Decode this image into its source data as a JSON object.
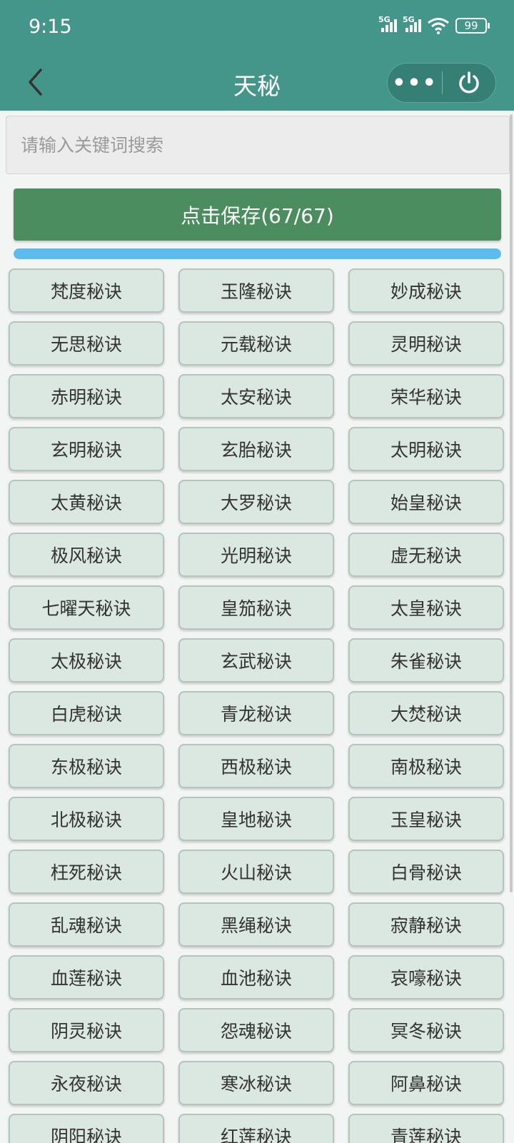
{
  "status": {
    "time": "9:15",
    "sim1": "5G",
    "sim2": "5G",
    "wifi_icon": "wifi-icon",
    "battery": "99"
  },
  "nav": {
    "title": "天秘",
    "back_icon": "back-arrow-icon",
    "more_icon": "more-icon",
    "more_glyph": "•••",
    "power_icon": "power-icon"
  },
  "search": {
    "placeholder": "请输入关键词搜索",
    "value": ""
  },
  "save": {
    "label": "点击保存(67/67)",
    "progress": 1.0
  },
  "colors": {
    "header": "#45968a",
    "save_button": "#4b8d5e",
    "progress": "#5cbcee",
    "item_bg": "#dbe7e1"
  },
  "items": [
    "梵度秘诀",
    "玉隆秘诀",
    "妙成秘诀",
    "无思秘诀",
    "元载秘诀",
    "灵明秘诀",
    "赤明秘诀",
    "太安秘诀",
    "荣华秘诀",
    "玄明秘诀",
    "玄胎秘诀",
    "太明秘诀",
    "太黄秘诀",
    "大罗秘诀",
    "始皇秘诀",
    "极风秘诀",
    "光明秘诀",
    "虚无秘诀",
    "七曜天秘诀",
    "皇笳秘诀",
    "太皇秘诀",
    "太极秘诀",
    "玄武秘诀",
    "朱雀秘诀",
    "白虎秘诀",
    "青龙秘诀",
    "大焚秘诀",
    "东极秘诀",
    "西极秘诀",
    "南极秘诀",
    "北极秘诀",
    "皇地秘诀",
    "玉皇秘诀",
    "枉死秘诀",
    "火山秘诀",
    "白骨秘诀",
    "乱魂秘诀",
    "黑绳秘诀",
    "寂静秘诀",
    "血莲秘诀",
    "血池秘诀",
    "哀嚎秘诀",
    "阴灵秘诀",
    "怨魂秘诀",
    "冥冬秘诀",
    "永夜秘诀",
    "寒冰秘诀",
    "阿鼻秘诀",
    "阴阳秘诀",
    "红莲秘诀",
    "青莲秘诀"
  ]
}
